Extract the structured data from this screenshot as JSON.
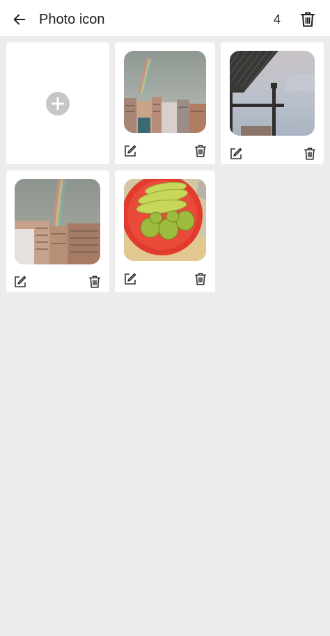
{
  "header": {
    "title": "Photo icon",
    "count": "4",
    "back_icon": "arrow-left-icon",
    "delete_icon": "trash-icon"
  },
  "grid": {
    "add_icon": "plus-circle-icon",
    "photos": [
      {
        "subject": "rainbow-over-buildings",
        "edit_icon": "edit-icon",
        "delete_icon": "trash-icon"
      },
      {
        "subject": "window-frame-sky",
        "edit_icon": "edit-icon",
        "delete_icon": "trash-icon"
      },
      {
        "subject": "rainbow-over-buildings-2",
        "edit_icon": "edit-icon",
        "delete_icon": "trash-icon"
      },
      {
        "subject": "bowl-of-fruit",
        "edit_icon": "edit-icon",
        "delete_icon": "trash-icon"
      }
    ]
  },
  "colors": {
    "background": "#ececec",
    "card": "#ffffff",
    "add_circle": "#c6c6c6",
    "icon": "#333333"
  }
}
